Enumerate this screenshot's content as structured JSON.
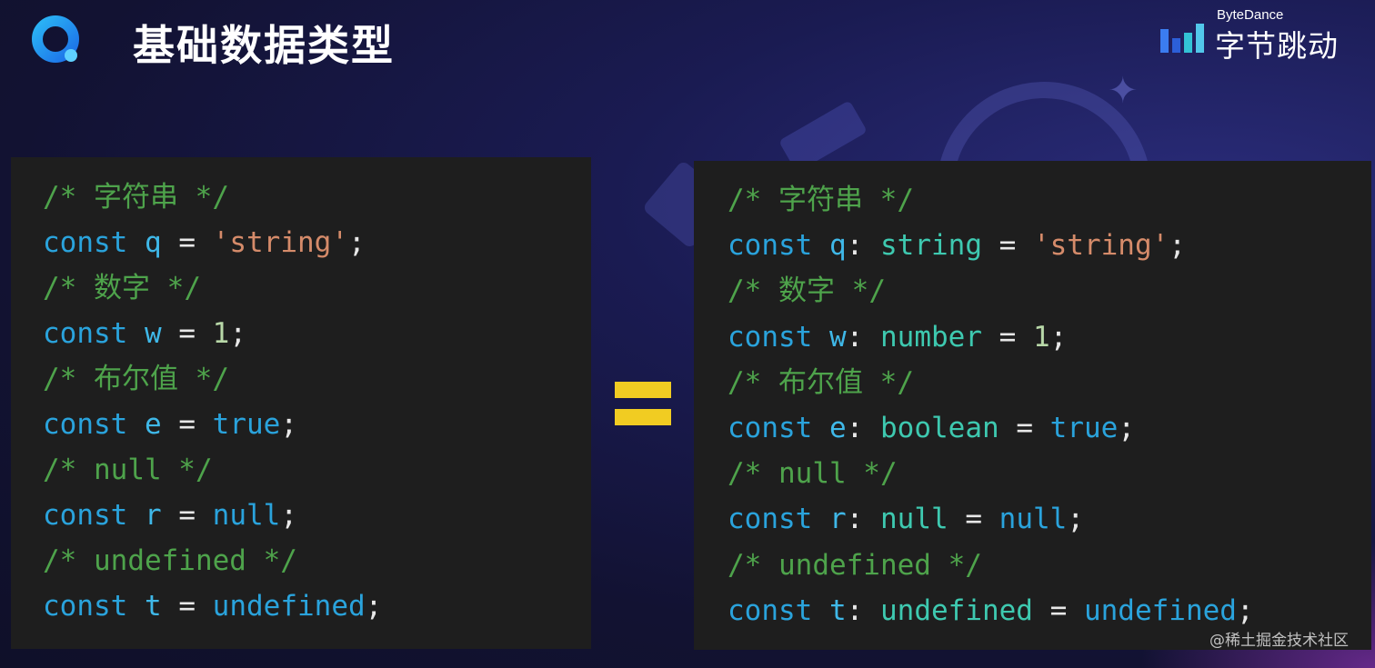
{
  "header": {
    "title": "基础数据类型",
    "brand_en": "ByteDance",
    "brand_cn": "字节跳动"
  },
  "left_code": {
    "lines": [
      [
        {
          "t": "/* 字符串 */",
          "c": "comment"
        }
      ],
      [
        {
          "t": "const",
          "c": "kw"
        },
        {
          "t": " "
        },
        {
          "t": "q",
          "c": "var"
        },
        {
          "t": " = ",
          "c": "op"
        },
        {
          "t": "'string'",
          "c": "str"
        },
        {
          "t": ";",
          "c": "op"
        }
      ],
      [
        {
          "t": "/* 数字 */",
          "c": "comment"
        }
      ],
      [
        {
          "t": "const",
          "c": "kw"
        },
        {
          "t": " "
        },
        {
          "t": "w",
          "c": "var"
        },
        {
          "t": " = ",
          "c": "op"
        },
        {
          "t": "1",
          "c": "num"
        },
        {
          "t": ";",
          "c": "op"
        }
      ],
      [
        {
          "t": "/* 布尔值 */",
          "c": "comment"
        }
      ],
      [
        {
          "t": "const",
          "c": "kw"
        },
        {
          "t": " "
        },
        {
          "t": "e",
          "c": "var"
        },
        {
          "t": " = ",
          "c": "op"
        },
        {
          "t": "true",
          "c": "lit"
        },
        {
          "t": ";",
          "c": "op"
        }
      ],
      [
        {
          "t": "/* null */",
          "c": "comment"
        }
      ],
      [
        {
          "t": "const",
          "c": "kw"
        },
        {
          "t": " "
        },
        {
          "t": "r",
          "c": "var"
        },
        {
          "t": " = ",
          "c": "op"
        },
        {
          "t": "null",
          "c": "lit"
        },
        {
          "t": ";",
          "c": "op"
        }
      ],
      [
        {
          "t": "/* undefined */",
          "c": "comment"
        }
      ],
      [
        {
          "t": "const",
          "c": "kw"
        },
        {
          "t": " "
        },
        {
          "t": "t",
          "c": "var"
        },
        {
          "t": " = ",
          "c": "op"
        },
        {
          "t": "undefined",
          "c": "lit"
        },
        {
          "t": ";",
          "c": "op"
        }
      ]
    ]
  },
  "right_code": {
    "lines": [
      [
        {
          "t": "/* 字符串 */",
          "c": "comment"
        }
      ],
      [
        {
          "t": "const",
          "c": "kw"
        },
        {
          "t": " "
        },
        {
          "t": "q",
          "c": "var"
        },
        {
          "t": ": ",
          "c": "op"
        },
        {
          "t": "string",
          "c": "type"
        },
        {
          "t": " = ",
          "c": "op"
        },
        {
          "t": "'string'",
          "c": "str"
        },
        {
          "t": ";",
          "c": "op"
        }
      ],
      [
        {
          "t": "/* 数字 */",
          "c": "comment"
        }
      ],
      [
        {
          "t": "const",
          "c": "kw"
        },
        {
          "t": " "
        },
        {
          "t": "w",
          "c": "var"
        },
        {
          "t": ": ",
          "c": "op"
        },
        {
          "t": "number",
          "c": "type"
        },
        {
          "t": " = ",
          "c": "op"
        },
        {
          "t": "1",
          "c": "num"
        },
        {
          "t": ";",
          "c": "op"
        }
      ],
      [
        {
          "t": "/* 布尔值 */",
          "c": "comment"
        }
      ],
      [
        {
          "t": "const",
          "c": "kw"
        },
        {
          "t": " "
        },
        {
          "t": "e",
          "c": "var"
        },
        {
          "t": ": ",
          "c": "op"
        },
        {
          "t": "boolean",
          "c": "type"
        },
        {
          "t": " = ",
          "c": "op"
        },
        {
          "t": "true",
          "c": "lit"
        },
        {
          "t": ";",
          "c": "op"
        }
      ],
      [
        {
          "t": "/* null */",
          "c": "comment"
        }
      ],
      [
        {
          "t": "const",
          "c": "kw"
        },
        {
          "t": " "
        },
        {
          "t": "r",
          "c": "var"
        },
        {
          "t": ": ",
          "c": "op"
        },
        {
          "t": "null",
          "c": "type"
        },
        {
          "t": " = ",
          "c": "op"
        },
        {
          "t": "null",
          "c": "lit"
        },
        {
          "t": ";",
          "c": "op"
        }
      ],
      [
        {
          "t": "/* undefined */",
          "c": "comment"
        }
      ],
      [
        {
          "t": "const",
          "c": "kw"
        },
        {
          "t": " "
        },
        {
          "t": "t",
          "c": "var"
        },
        {
          "t": ": ",
          "c": "op"
        },
        {
          "t": "undefined",
          "c": "type"
        },
        {
          "t": " = ",
          "c": "op"
        },
        {
          "t": "undefined",
          "c": "lit"
        },
        {
          "t": ";",
          "c": "op"
        }
      ]
    ]
  },
  "watermark": "@稀土掘金技术社区",
  "icons": {
    "logo": "app-logo-icon",
    "brand": "bytedance-logo-icon",
    "equals": "equals-icon"
  },
  "colors": {
    "background": "#141438",
    "code_background": "#1e1e1e",
    "equals": "#f1cc22",
    "comment": "#4ea34b",
    "keyword": "#2aa3dc",
    "string": "#d58b6a",
    "type": "#3ec9b0"
  }
}
